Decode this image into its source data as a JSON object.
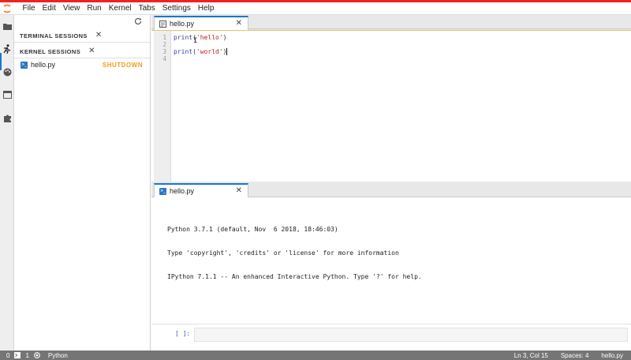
{
  "menubar": {
    "items": [
      "File",
      "Edit",
      "View",
      "Run",
      "Kernel",
      "Tabs",
      "Settings",
      "Help"
    ]
  },
  "sidebar": {
    "terminal_sessions_label": "TERMINAL SESSIONS",
    "kernel_sessions_label": "KERNEL SESSIONS",
    "kernel_items": [
      {
        "name": "hello.py",
        "action": "SHUTDOWN"
      }
    ]
  },
  "editor_tab": {
    "label": "hello.py"
  },
  "editor": {
    "line_numbers": [
      "1",
      "2",
      "3",
      "4"
    ]
  },
  "console_tab": {
    "label": "hello.py"
  },
  "console": {
    "output": [
      "Python 3.7.1 (default, Nov  6 2018, 18:46:03)",
      "Type 'copyright', 'credits' or 'license' for more information",
      "IPython 7.1.1 -- An enhanced Interactive Python. Type '?' for help."
    ],
    "prompt": "[ ]:"
  },
  "statusbar": {
    "terminals_count": "0",
    "kernels_count": "1",
    "kernel_name": "Python",
    "cursor_position": "Ln 3, Col 15",
    "spaces": "Spaces: 4",
    "file_name": "hello.py"
  },
  "colors": {
    "accent": "#1976d2",
    "top_bar": "#ee2222",
    "shutdown": "#f29a1f",
    "statusbar": "#757575"
  }
}
